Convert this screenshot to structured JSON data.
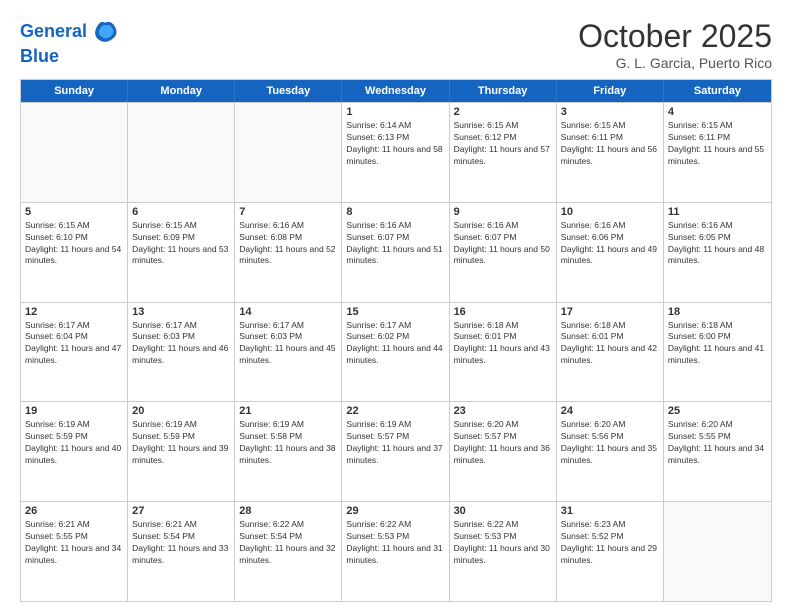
{
  "header": {
    "logo_line1": "General",
    "logo_line2": "Blue",
    "month_title": "October 2025",
    "location": "G. L. Garcia, Puerto Rico"
  },
  "weekdays": [
    "Sunday",
    "Monday",
    "Tuesday",
    "Wednesday",
    "Thursday",
    "Friday",
    "Saturday"
  ],
  "rows": [
    [
      {
        "day": "",
        "empty": true
      },
      {
        "day": "",
        "empty": true
      },
      {
        "day": "",
        "empty": true
      },
      {
        "day": "1",
        "sunrise": "Sunrise: 6:14 AM",
        "sunset": "Sunset: 6:13 PM",
        "daylight": "Daylight: 11 hours and 58 minutes."
      },
      {
        "day": "2",
        "sunrise": "Sunrise: 6:15 AM",
        "sunset": "Sunset: 6:12 PM",
        "daylight": "Daylight: 11 hours and 57 minutes."
      },
      {
        "day": "3",
        "sunrise": "Sunrise: 6:15 AM",
        "sunset": "Sunset: 6:11 PM",
        "daylight": "Daylight: 11 hours and 56 minutes."
      },
      {
        "day": "4",
        "sunrise": "Sunrise: 6:15 AM",
        "sunset": "Sunset: 6:11 PM",
        "daylight": "Daylight: 11 hours and 55 minutes."
      }
    ],
    [
      {
        "day": "5",
        "sunrise": "Sunrise: 6:15 AM",
        "sunset": "Sunset: 6:10 PM",
        "daylight": "Daylight: 11 hours and 54 minutes."
      },
      {
        "day": "6",
        "sunrise": "Sunrise: 6:15 AM",
        "sunset": "Sunset: 6:09 PM",
        "daylight": "Daylight: 11 hours and 53 minutes."
      },
      {
        "day": "7",
        "sunrise": "Sunrise: 6:16 AM",
        "sunset": "Sunset: 6:08 PM",
        "daylight": "Daylight: 11 hours and 52 minutes."
      },
      {
        "day": "8",
        "sunrise": "Sunrise: 6:16 AM",
        "sunset": "Sunset: 6:07 PM",
        "daylight": "Daylight: 11 hours and 51 minutes."
      },
      {
        "day": "9",
        "sunrise": "Sunrise: 6:16 AM",
        "sunset": "Sunset: 6:07 PM",
        "daylight": "Daylight: 11 hours and 50 minutes."
      },
      {
        "day": "10",
        "sunrise": "Sunrise: 6:16 AM",
        "sunset": "Sunset: 6:06 PM",
        "daylight": "Daylight: 11 hours and 49 minutes."
      },
      {
        "day": "11",
        "sunrise": "Sunrise: 6:16 AM",
        "sunset": "Sunset: 6:05 PM",
        "daylight": "Daylight: 11 hours and 48 minutes."
      }
    ],
    [
      {
        "day": "12",
        "sunrise": "Sunrise: 6:17 AM",
        "sunset": "Sunset: 6:04 PM",
        "daylight": "Daylight: 11 hours and 47 minutes."
      },
      {
        "day": "13",
        "sunrise": "Sunrise: 6:17 AM",
        "sunset": "Sunset: 6:03 PM",
        "daylight": "Daylight: 11 hours and 46 minutes."
      },
      {
        "day": "14",
        "sunrise": "Sunrise: 6:17 AM",
        "sunset": "Sunset: 6:03 PM",
        "daylight": "Daylight: 11 hours and 45 minutes."
      },
      {
        "day": "15",
        "sunrise": "Sunrise: 6:17 AM",
        "sunset": "Sunset: 6:02 PM",
        "daylight": "Daylight: 11 hours and 44 minutes."
      },
      {
        "day": "16",
        "sunrise": "Sunrise: 6:18 AM",
        "sunset": "Sunset: 6:01 PM",
        "daylight": "Daylight: 11 hours and 43 minutes."
      },
      {
        "day": "17",
        "sunrise": "Sunrise: 6:18 AM",
        "sunset": "Sunset: 6:01 PM",
        "daylight": "Daylight: 11 hours and 42 minutes."
      },
      {
        "day": "18",
        "sunrise": "Sunrise: 6:18 AM",
        "sunset": "Sunset: 6:00 PM",
        "daylight": "Daylight: 11 hours and 41 minutes."
      }
    ],
    [
      {
        "day": "19",
        "sunrise": "Sunrise: 6:19 AM",
        "sunset": "Sunset: 5:59 PM",
        "daylight": "Daylight: 11 hours and 40 minutes."
      },
      {
        "day": "20",
        "sunrise": "Sunrise: 6:19 AM",
        "sunset": "Sunset: 5:59 PM",
        "daylight": "Daylight: 11 hours and 39 minutes."
      },
      {
        "day": "21",
        "sunrise": "Sunrise: 6:19 AM",
        "sunset": "Sunset: 5:58 PM",
        "daylight": "Daylight: 11 hours and 38 minutes."
      },
      {
        "day": "22",
        "sunrise": "Sunrise: 6:19 AM",
        "sunset": "Sunset: 5:57 PM",
        "daylight": "Daylight: 11 hours and 37 minutes."
      },
      {
        "day": "23",
        "sunrise": "Sunrise: 6:20 AM",
        "sunset": "Sunset: 5:57 PM",
        "daylight": "Daylight: 11 hours and 36 minutes."
      },
      {
        "day": "24",
        "sunrise": "Sunrise: 6:20 AM",
        "sunset": "Sunset: 5:56 PM",
        "daylight": "Daylight: 11 hours and 35 minutes."
      },
      {
        "day": "25",
        "sunrise": "Sunrise: 6:20 AM",
        "sunset": "Sunset: 5:55 PM",
        "daylight": "Daylight: 11 hours and 34 minutes."
      }
    ],
    [
      {
        "day": "26",
        "sunrise": "Sunrise: 6:21 AM",
        "sunset": "Sunset: 5:55 PM",
        "daylight": "Daylight: 11 hours and 34 minutes."
      },
      {
        "day": "27",
        "sunrise": "Sunrise: 6:21 AM",
        "sunset": "Sunset: 5:54 PM",
        "daylight": "Daylight: 11 hours and 33 minutes."
      },
      {
        "day": "28",
        "sunrise": "Sunrise: 6:22 AM",
        "sunset": "Sunset: 5:54 PM",
        "daylight": "Daylight: 11 hours and 32 minutes."
      },
      {
        "day": "29",
        "sunrise": "Sunrise: 6:22 AM",
        "sunset": "Sunset: 5:53 PM",
        "daylight": "Daylight: 11 hours and 31 minutes."
      },
      {
        "day": "30",
        "sunrise": "Sunrise: 6:22 AM",
        "sunset": "Sunset: 5:53 PM",
        "daylight": "Daylight: 11 hours and 30 minutes."
      },
      {
        "day": "31",
        "sunrise": "Sunrise: 6:23 AM",
        "sunset": "Sunset: 5:52 PM",
        "daylight": "Daylight: 11 hours and 29 minutes."
      },
      {
        "day": "",
        "empty": true
      }
    ]
  ]
}
